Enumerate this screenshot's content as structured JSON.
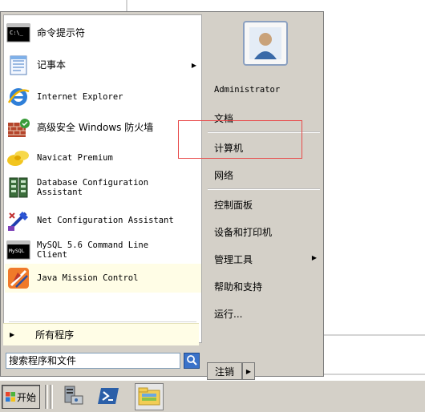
{
  "start_menu": {
    "programs": [
      {
        "label": "命令提示符",
        "icon": "cmd-icon",
        "has_submenu": false
      },
      {
        "label": "记事本",
        "icon": "notepad-icon",
        "has_submenu": true
      },
      {
        "label": "Internet Explorer",
        "icon": "ie-icon",
        "has_submenu": false
      },
      {
        "label": "高级安全 Windows 防火墙",
        "icon": "firewall-icon",
        "has_submenu": false
      },
      {
        "label": "Navicat Premium",
        "icon": "navicat-icon",
        "has_submenu": false
      },
      {
        "label": "Database Configuration\nAssistant",
        "icon": "db-config-icon",
        "has_submenu": false
      },
      {
        "label": "Net Configuration Assistant",
        "icon": "net-config-icon",
        "has_submenu": false
      },
      {
        "label": "MySQL 5.6 Command Line\nClient",
        "icon": "mysql-icon",
        "has_submenu": false
      },
      {
        "label": "Java Mission Control",
        "icon": "java-mission-control-icon",
        "has_submenu": false
      }
    ],
    "all_programs_label": "所有程序",
    "search_placeholder": "搜索程序和文件",
    "right_items": [
      {
        "label": "Administrator"
      },
      {
        "label": "文档"
      },
      {
        "label": "计算机"
      },
      {
        "label": "网络"
      },
      {
        "label": "控制面板"
      },
      {
        "label": "设备和打印机"
      },
      {
        "label": "管理工具",
        "has_submenu": true
      },
      {
        "label": "帮助和支持"
      },
      {
        "label": "运行..."
      }
    ],
    "logoff_label": "注销"
  },
  "taskbar": {
    "start_label": "开始",
    "pinned": [
      {
        "icon": "server-manager-icon"
      },
      {
        "icon": "powershell-icon"
      },
      {
        "icon": "explorer-icon"
      }
    ]
  }
}
